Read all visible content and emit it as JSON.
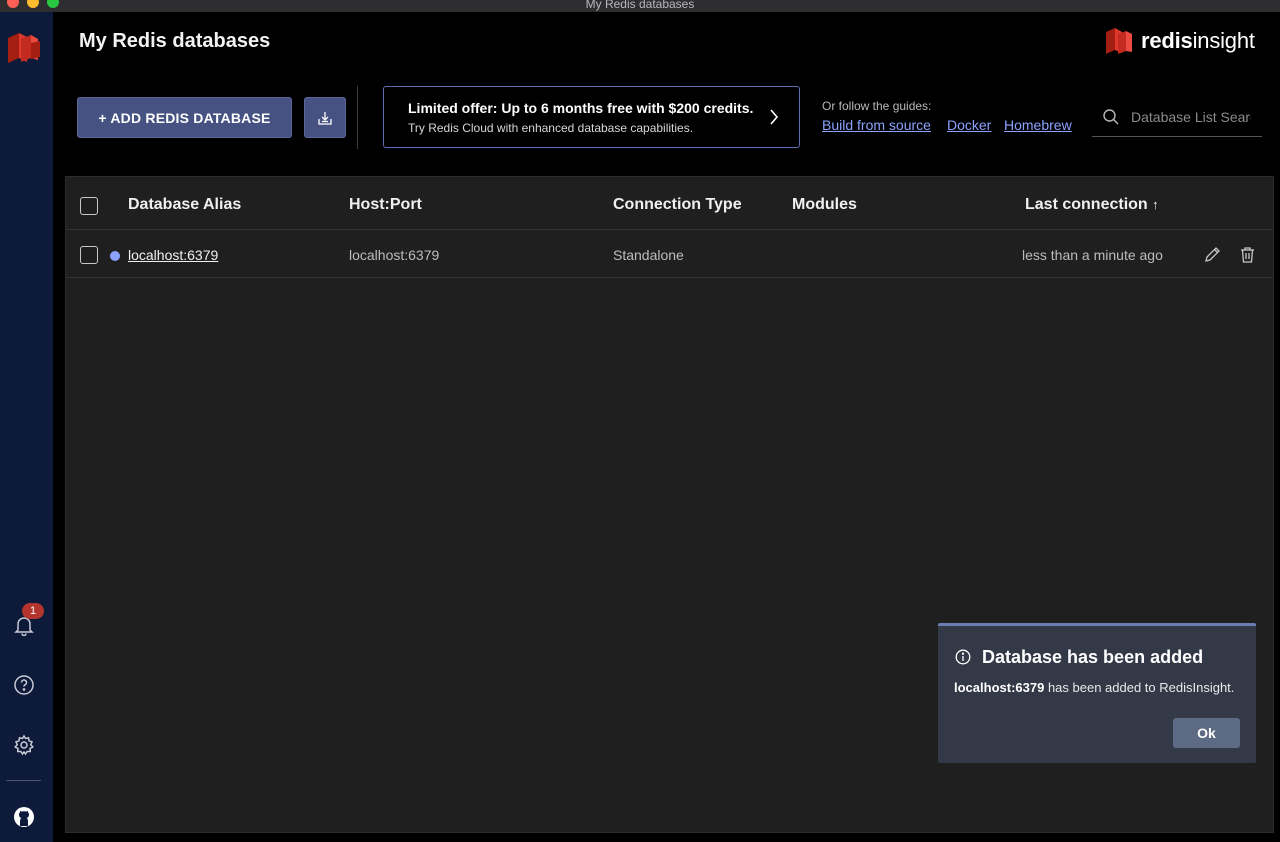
{
  "window": {
    "title": "My Redis databases"
  },
  "sidebar": {
    "notification_count": "1",
    "icons": [
      "redis-logo-icon",
      "bell-icon",
      "help-icon",
      "gear-icon",
      "github-icon"
    ]
  },
  "header": {
    "title": "My Redis databases",
    "brand_bold": "redis",
    "brand_light": "insight"
  },
  "toolbar": {
    "add_label": "+ ADD REDIS DATABASE",
    "offer_title": "Limited offer: Up to 6 months free with $200 credits.",
    "offer_subtitle": "Try Redis Cloud with enhanced database capabilities.",
    "guides_label": "Or follow the guides:",
    "guides": [
      "Build from source",
      "Docker",
      "Homebrew"
    ],
    "search_placeholder": "Database List Search"
  },
  "table": {
    "columns": [
      "Database Alias",
      "Host:Port",
      "Connection Type",
      "Modules",
      "Last connection"
    ],
    "sort_indicator": "↑",
    "rows": [
      {
        "alias": "localhost:6379",
        "host_port": "localhost:6379",
        "connection_type": "Standalone",
        "modules": "",
        "last_connection": "less than a minute ago"
      }
    ]
  },
  "toast": {
    "title": "Database has been added",
    "db_name": "localhost:6379",
    "message": " has been added to RedisInsight.",
    "ok_label": "Ok"
  },
  "colors": {
    "accent": "#465282",
    "link": "#8ba2ff",
    "sidebar_bg": "#0e1a3a",
    "brand_red": "#dc382c",
    "badge": "#b3352d"
  }
}
